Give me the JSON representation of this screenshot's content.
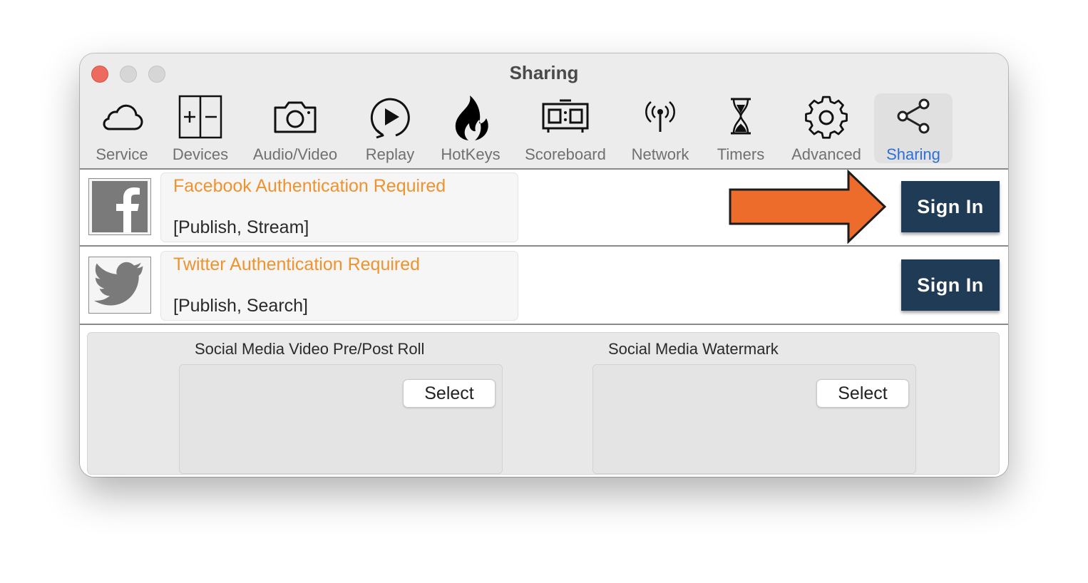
{
  "window": {
    "title": "Sharing"
  },
  "toolbar": {
    "items": [
      {
        "label": "Service",
        "icon": "cloud-icon"
      },
      {
        "label": "Devices",
        "icon": "devices-icon"
      },
      {
        "label": "Audio/Video",
        "icon": "camera-icon"
      },
      {
        "label": "Replay",
        "icon": "replay-icon"
      },
      {
        "label": "HotKeys",
        "icon": "flame-icon"
      },
      {
        "label": "Scoreboard",
        "icon": "scoreboard-icon"
      },
      {
        "label": "Network",
        "icon": "antenna-icon"
      },
      {
        "label": "Timers",
        "icon": "hourglass-icon"
      },
      {
        "label": "Advanced",
        "icon": "gear-icon"
      },
      {
        "label": "Sharing",
        "icon": "share-icon"
      }
    ],
    "selected": "Sharing"
  },
  "accounts": [
    {
      "service": "facebook",
      "icon": "facebook-logo-icon",
      "title": "Facebook Authentication Required",
      "permissions": "[Publish, Stream]",
      "button": "Sign In"
    },
    {
      "service": "twitter",
      "icon": "twitter-logo-icon",
      "title": "Twitter Authentication Required",
      "permissions": "[Publish, Search]",
      "button": "Sign In"
    }
  ],
  "media": {
    "preroll": {
      "label": "Social Media Video Pre/Post Roll",
      "button": "Select"
    },
    "watermark": {
      "label": "Social Media Watermark",
      "button": "Select"
    }
  },
  "annotation": {
    "type": "arrow",
    "color": "#ee6c2b",
    "points_to": "Sign In"
  },
  "colors": {
    "auth_title": "#f0922d",
    "sign_in_button": "#1f3b56",
    "selected_tab": "#2d6fd8"
  }
}
